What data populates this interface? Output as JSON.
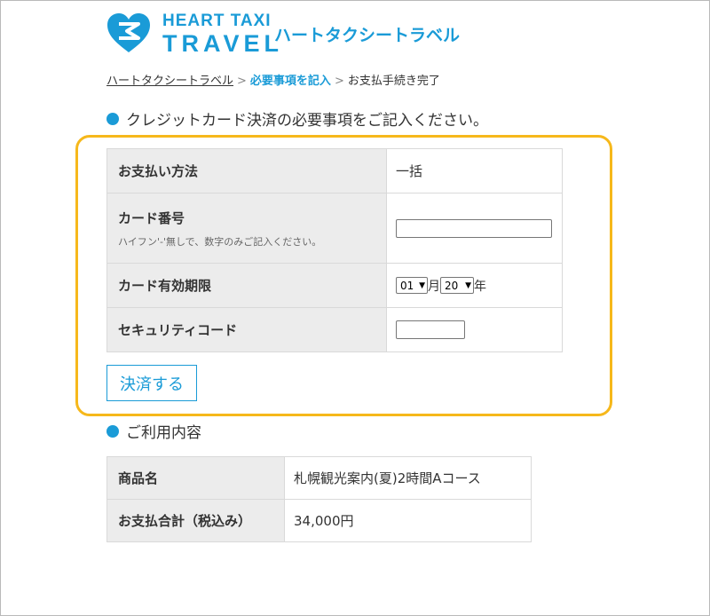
{
  "header": {
    "logo_top": "HEART TAXI",
    "logo_bottom": "TRAVEL",
    "site_title": "ハートタクシートラベル"
  },
  "breadcrumb": {
    "home": "ハートタクシートラベル",
    "separator": ">",
    "current": "必要事項を記入",
    "next": "お支払手続き完了"
  },
  "payment_section": {
    "heading": "クレジットカード決済の必要事項をご記入ください。",
    "method_label": "お支払い方法",
    "method_value": "一括",
    "card_number_label": "カード番号",
    "card_number_note": "ハイフン'-'無しで、数字のみご記入ください。",
    "card_number_value": "",
    "expiry_label": "カード有効期限",
    "expiry_month": "01",
    "month_unit": "月",
    "expiry_year": "20",
    "year_unit": "年",
    "security_label": "セキュリティコード",
    "security_value": "",
    "submit_label": "決済する"
  },
  "usage_section": {
    "heading": "ご利用内容",
    "product_label": "商品名",
    "product_value": "札幌観光案内(夏)2時間Aコース",
    "total_label": "お支払合計（税込み）",
    "total_value": "34,000円"
  },
  "colors": {
    "accent": "#1a9bd7",
    "highlight": "#f6b81b",
    "header_cell": "#ececec"
  }
}
